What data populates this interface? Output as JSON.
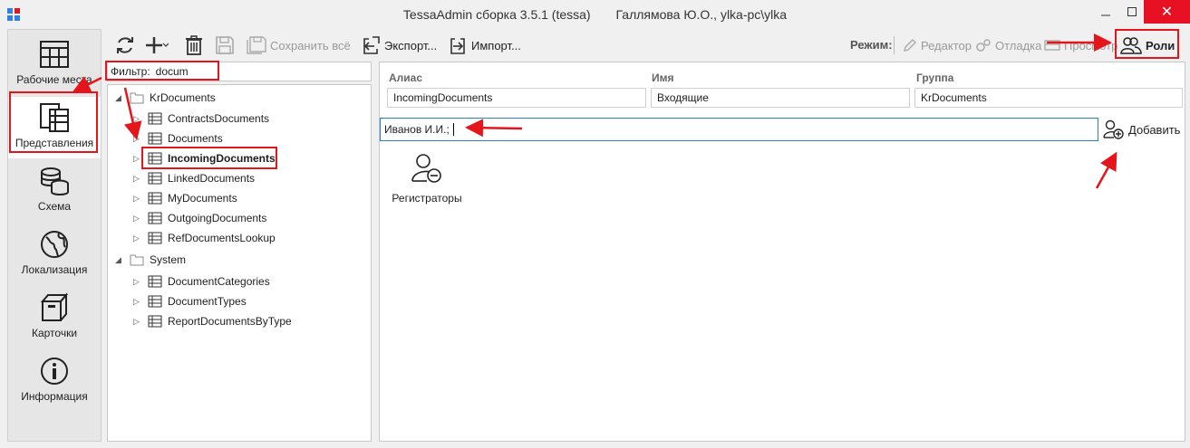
{
  "window": {
    "title": "TessaAdmin сборка 3.5.1 (tessa)",
    "user": "Галлямова Ю.О., ylka-pc\\ylka",
    "close_glyph": "✕"
  },
  "icons": {
    "app": "app-grid-icon",
    "refresh": "refresh-icon",
    "add": "plus-icon",
    "delete": "trash-icon",
    "save": "floppy-icon",
    "export": "export-icon",
    "import": "import-icon"
  },
  "colors": {
    "annotation": "#e4161b",
    "focus_border": "#2d7dd2",
    "close_button": "#e81123"
  },
  "nav": [
    {
      "label": "Рабочие места",
      "icon": "workspace-icon"
    },
    {
      "label": "Представления",
      "icon": "views-icon"
    },
    {
      "label": "Схема",
      "icon": "database-icon"
    },
    {
      "label": "Локализация",
      "icon": "globe-icon"
    },
    {
      "label": "Карточки",
      "icon": "box-icon"
    },
    {
      "label": "Информация",
      "icon": "info-icon"
    }
  ],
  "toolbar": {
    "save_all": "Сохранить всё",
    "export": "Экспорт...",
    "import": "Импорт...",
    "mode_label": "Режим:",
    "editor": "Редактор",
    "debug": "Отладка",
    "view": "Просмотр",
    "roles": "Роли"
  },
  "filter": {
    "label": "Фильтр:",
    "value": "docum"
  },
  "tree": {
    "groups": [
      {
        "name": "KrDocuments",
        "items": [
          "ContractsDocuments",
          "Documents",
          "IncomingDocuments",
          "LinkedDocuments",
          "MyDocuments",
          "OutgoingDocuments",
          "RefDocumentsLookup"
        ]
      },
      {
        "name": "System",
        "items": [
          "DocumentCategories",
          "DocumentTypes",
          "ReportDocumentsByType"
        ]
      }
    ],
    "selected": "IncomingDocuments"
  },
  "details": {
    "alias_header": "Алиас",
    "name_header": "Имя",
    "group_header": "Группа",
    "alias_value": "IncomingDocuments",
    "name_value": "Входящие",
    "group_value": "KrDocuments"
  },
  "roles_panel": {
    "input_value": "Иванов И.И.;",
    "add_label": "Добавить",
    "roles": [
      {
        "name": "Регистраторы",
        "icon": "user-remove-icon"
      }
    ]
  }
}
